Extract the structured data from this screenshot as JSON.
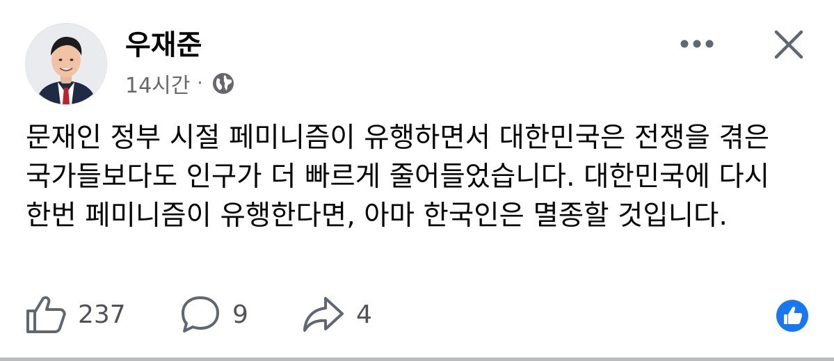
{
  "post": {
    "author": {
      "name": "우재준",
      "avatar_icon": "profile-photo"
    },
    "timestamp": "14시간",
    "separator": "·",
    "privacy_icon": "globe-icon",
    "text": "문재인 정부 시절 페미니즘이 유행하면서 대한민국은 전쟁을 겪은 국가들보다도 인구가 더 빠르게 줄어들었습니다. 대한민국에 다시 한번 페미니즘이 유행한다면, 아마 한국인은 멸종할 것입니다.",
    "actions": {
      "like": {
        "icon": "thumbs-up-icon",
        "count": "237"
      },
      "comment": {
        "icon": "comment-bubble-icon",
        "count": "9"
      },
      "share": {
        "icon": "share-arrow-icon",
        "count": "4"
      }
    },
    "reaction_badge": {
      "icon": "like-reaction-icon",
      "color": "#1877f2"
    },
    "header_buttons": {
      "more_icon": "more-options-icon",
      "close_icon": "close-icon"
    }
  },
  "colors": {
    "text": "#050505",
    "secondary_text": "#65676b",
    "icon": "#606770",
    "accent": "#1877f2"
  }
}
